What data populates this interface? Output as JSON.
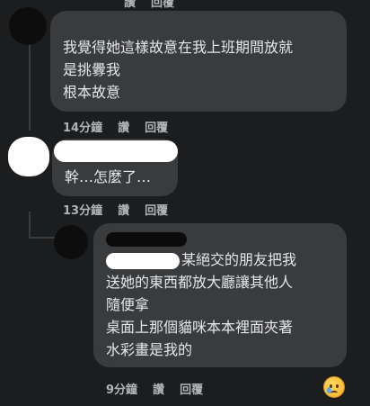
{
  "comments": [
    {
      "lines": [
        "我覺得她這樣故意在我上班期間放就",
        "是挑釁我",
        "根本故意"
      ],
      "time": "14分鐘",
      "like": "讚",
      "reply": "回覆"
    },
    {
      "lines": [
        "幹…怎麼了…"
      ],
      "time": "13分鐘",
      "like": "讚",
      "reply": "回覆"
    },
    {
      "lines_first_suffix": "某絕交的朋友把我",
      "lines": [
        "送她的東西都放大廳讓其他人",
        "隨便拿",
        "桌面上那個貓咪本本裡面夾著",
        "水彩畫是我的"
      ],
      "time": "9分鐘",
      "like": "讚",
      "reply": "回覆",
      "reaction": "crying-face-icon"
    }
  ],
  "top_meta": {
    "like": "讚",
    "reply": "回覆"
  }
}
